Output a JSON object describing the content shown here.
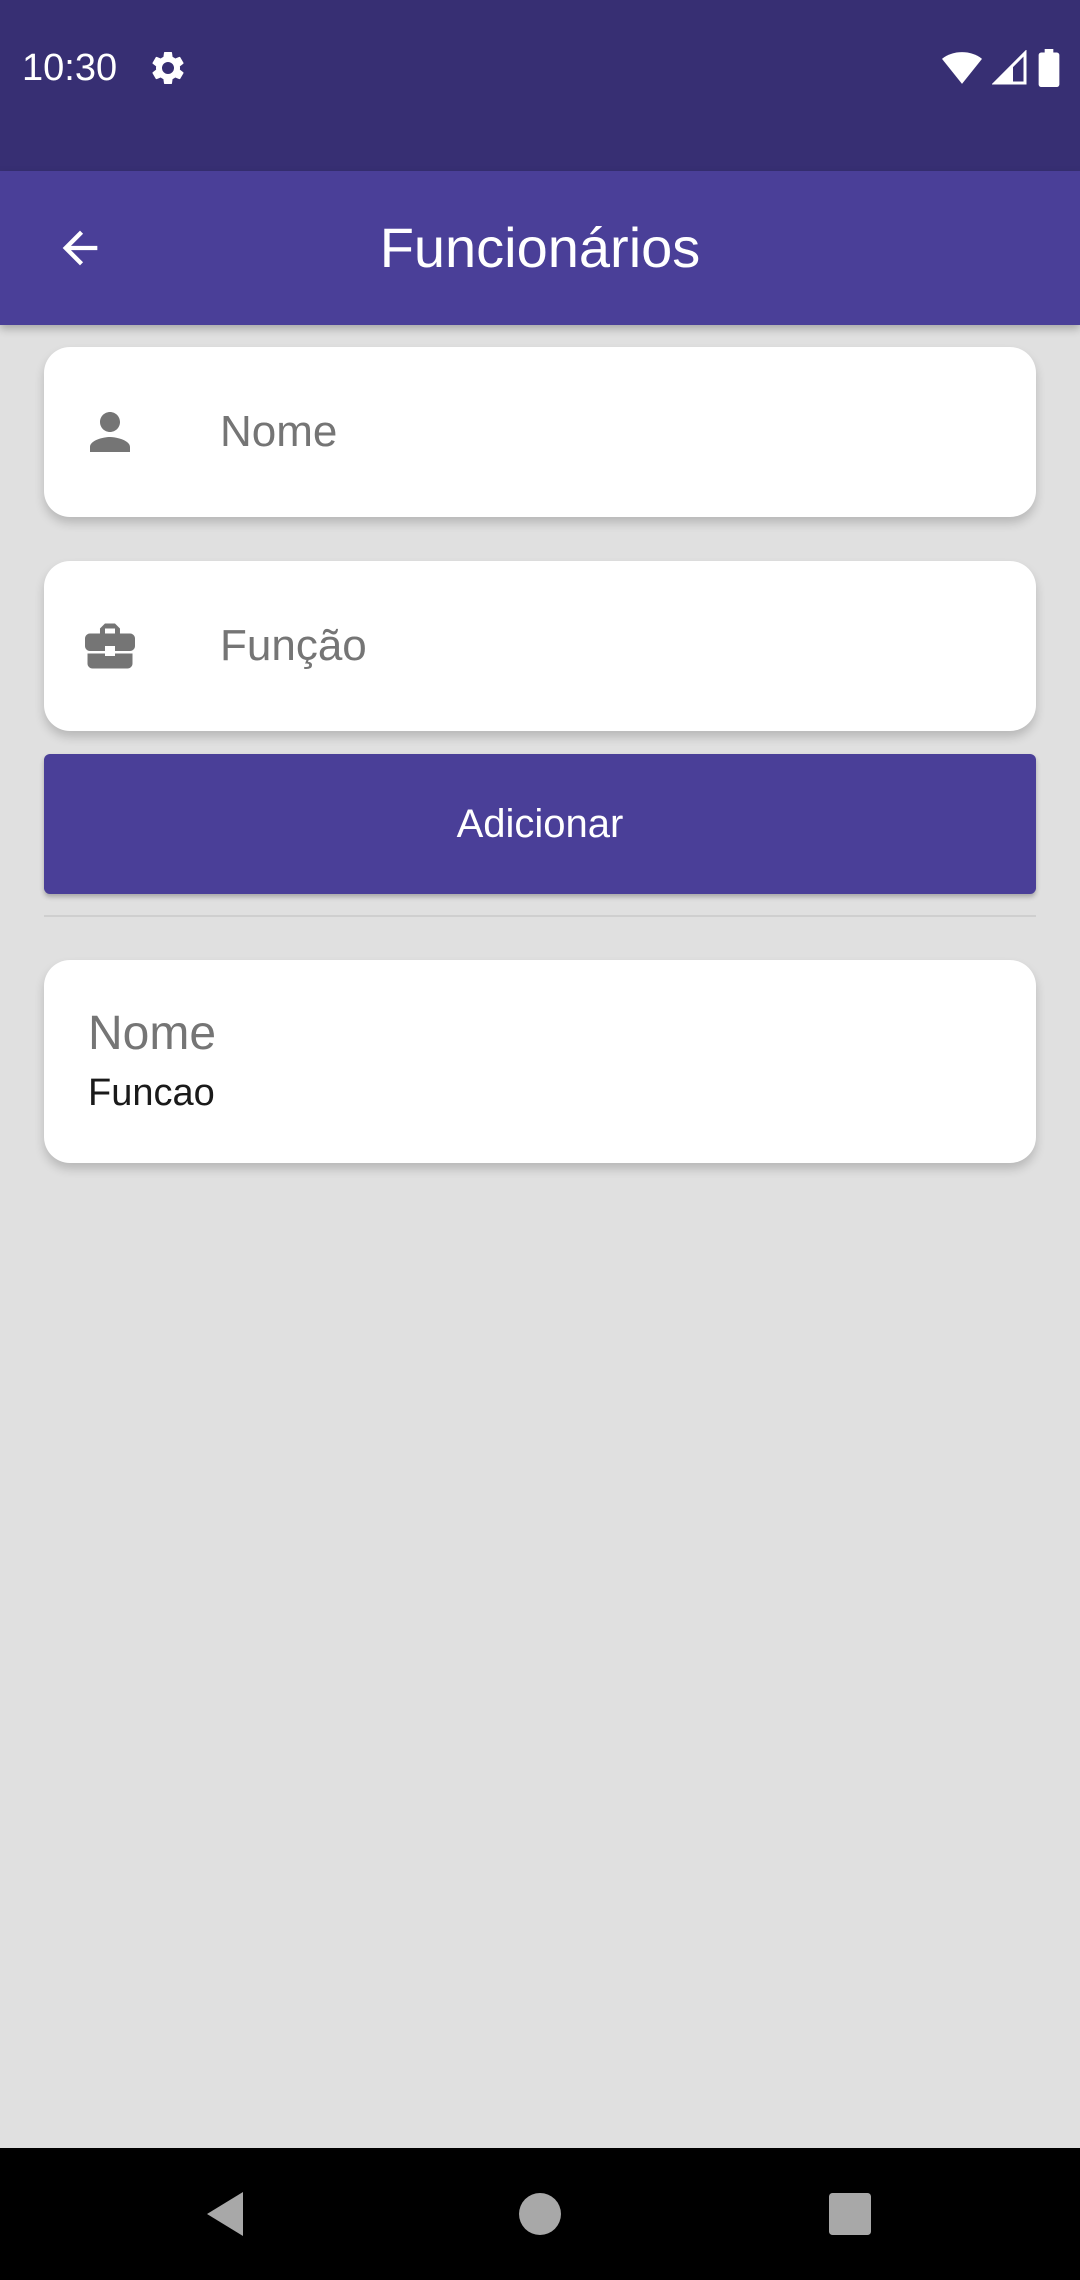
{
  "status_bar": {
    "time": "10:30",
    "icons": [
      "gear-icon",
      "wifi-icon",
      "signal-icon",
      "battery-icon"
    ]
  },
  "app_bar": {
    "title": "Funcionários",
    "back_icon": "arrow-back-icon"
  },
  "form": {
    "name_field": {
      "icon": "person-icon",
      "placeholder": "Nome",
      "value": ""
    },
    "role_field": {
      "icon": "briefcase-icon",
      "placeholder": "Função",
      "value": ""
    },
    "add_button_label": "Adicionar"
  },
  "employees": [
    {
      "name": "Nome",
      "role": "Funcao"
    }
  ],
  "nav_bar": {
    "icons": [
      "back-triangle-icon",
      "home-circle-icon",
      "recents-square-icon"
    ]
  },
  "colors": {
    "status_bar": "#372f73",
    "primary": "#4a3f98",
    "background": "#e0e0e0",
    "card": "#ffffff"
  }
}
